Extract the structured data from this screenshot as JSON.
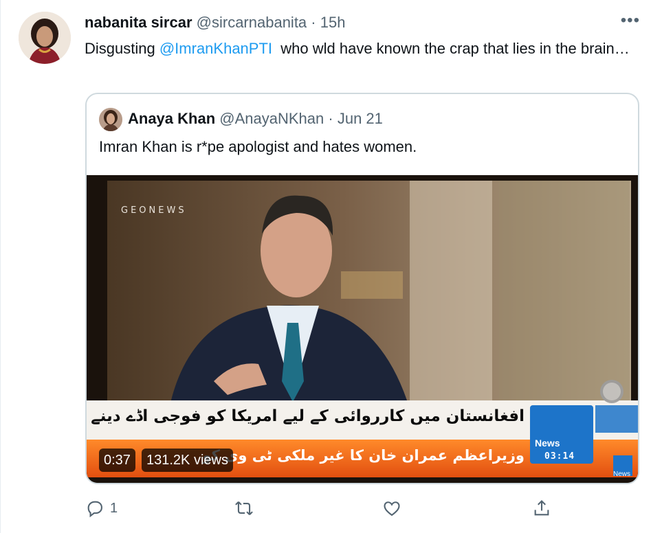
{
  "tweet": {
    "author_name": "nabanita sircar",
    "author_handle": "@sircarnabanita",
    "separator": "·",
    "time": "15h",
    "more_icon": "more-icon",
    "text_before": "Disgusting ",
    "mention": "@ImranKhanPTI",
    "text_after": "  who wld have known the crap that lies in the brain…"
  },
  "quote": {
    "author_name": "Anaya Khan",
    "author_handle": "@AnayaNKhan",
    "separator": "·",
    "date": "Jun 21",
    "text": "Imran Khan is r*pe apologist and hates women."
  },
  "video": {
    "watermark": "GEONEWS",
    "ticker_line1": "افغانستان میں کارروائی کے لیے امریکا کو فوجی اڈے دینے سے انکار",
    "ticker_line2": "وزیراعظم عمران خان کا غیر ملکی ٹی وی کو",
    "logo_text": "News",
    "logo_time": "03:14",
    "corner_logo": "News",
    "duration": "0:37",
    "views": "131.2K views"
  },
  "actions": {
    "reply_count": "1",
    "icons": [
      "reply-icon",
      "retweet-icon",
      "like-icon",
      "share-icon"
    ]
  },
  "colors": {
    "accent": "#1d9bf0",
    "muted": "#536471",
    "border": "#cfd9de",
    "ticker_orange": "#f26a1b"
  }
}
